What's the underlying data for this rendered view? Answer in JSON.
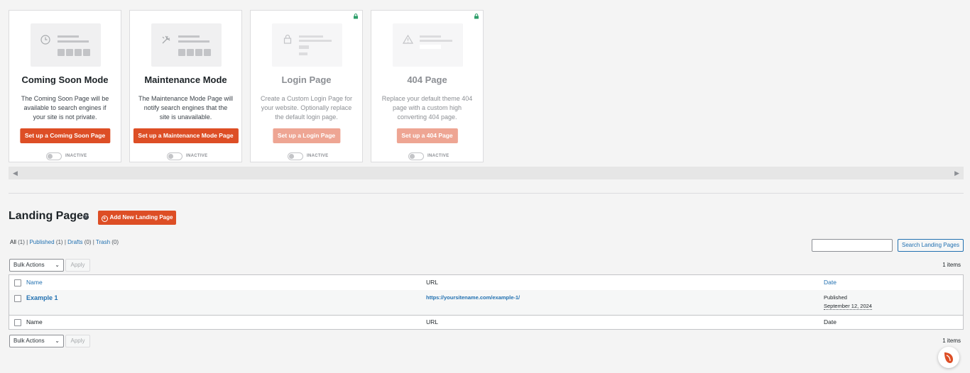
{
  "cards": [
    {
      "title": "Coming Soon Mode",
      "desc_lines": [
        "The Coming Soon Page will be",
        "available to search engines if",
        "your site is not private."
      ],
      "button": "Set up a Coming Soon Page",
      "status": "INACTIVE",
      "icon": "clock-icon"
    },
    {
      "title": "Maintenance Mode",
      "desc_lines": [
        "The Maintenance Mode Page will",
        "notify search engines that the",
        "site is unavailable."
      ],
      "button": "Set up a Maintenance Mode Page",
      "status": "INACTIVE",
      "icon": "tools-icon"
    },
    {
      "title": "Login Page",
      "desc_lines": [
        "Create a Custom Login Page for",
        "your website. Optionally replace",
        "the default login page."
      ],
      "button": "Set up a Login Page",
      "status": "INACTIVE",
      "icon": "lock-icon",
      "locked": true
    },
    {
      "title": "404 Page",
      "desc_lines": [
        "Replace your default theme 404",
        "page with a custom high",
        "converting 404 page."
      ],
      "button": "Set up a 404 Page",
      "status": "INACTIVE",
      "icon": "warning-icon",
      "locked": true
    }
  ],
  "landing": {
    "title": "Landing Pages",
    "add_button": "Add New Landing Page",
    "filters": {
      "all": "All",
      "all_count": "(1)",
      "published": "Published",
      "published_count": "(1)",
      "drafts": "Drafts",
      "drafts_count": "(0)",
      "trash": "Trash",
      "trash_count": "(0)"
    },
    "search_button": "Search Landing Pages",
    "search_value": "",
    "bulk_actions": "Bulk Actions",
    "apply": "Apply",
    "items_count": "1 items",
    "columns": {
      "name": "Name",
      "url": "URL",
      "date": "Date"
    },
    "rows": [
      {
        "name": "Example 1",
        "url": "https://yoursitename.com/example-1/",
        "status": "Published",
        "date": "September 12, 2024"
      }
    ]
  },
  "colors": {
    "accent": "#dd4e25",
    "link": "#2271b1"
  }
}
